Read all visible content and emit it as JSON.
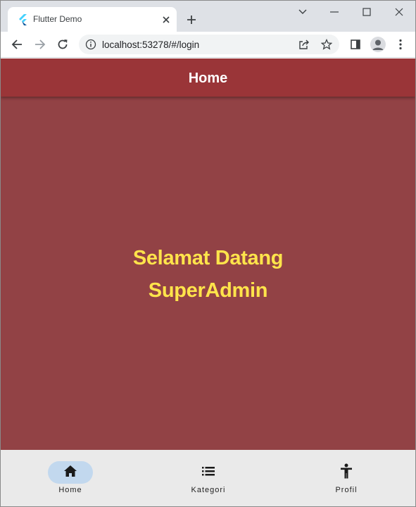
{
  "browser": {
    "tab_title": "Flutter Demo",
    "url": "localhost:53278/#/login"
  },
  "app": {
    "appbar_title": "Home",
    "welcome_line1": "Selamat Datang",
    "welcome_line2": "SuperAdmin"
  },
  "bottom_nav": {
    "items": [
      {
        "label": "Home",
        "icon": "home-icon",
        "active": true
      },
      {
        "label": "Kategori",
        "icon": "list-icon",
        "active": false
      },
      {
        "label": "Profil",
        "icon": "accessibility-icon",
        "active": false
      }
    ]
  },
  "colors": {
    "appbar": "#9a3538",
    "body": "#924245",
    "welcome_text": "#ffe44b",
    "nav_background": "#eaeaea",
    "nav_active_pill": "#c2d8ee"
  }
}
